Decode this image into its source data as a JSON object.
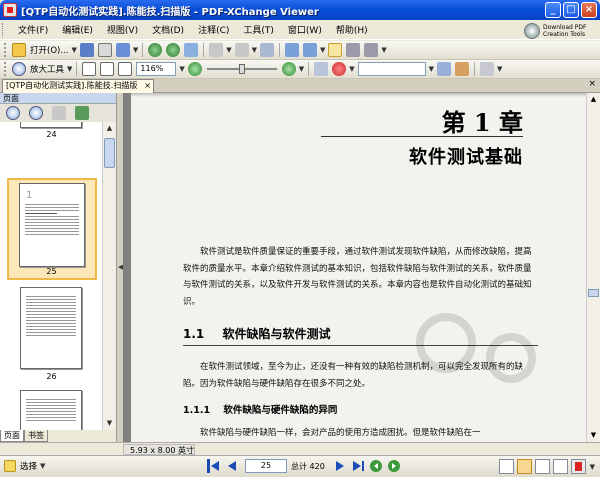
{
  "window": {
    "title": "[QTP自动化测试实践].陈能技.扫描版 - PDF-XChange Viewer"
  },
  "menu": {
    "items": [
      "文件(F)",
      "编辑(E)",
      "视图(V)",
      "文档(D)",
      "注释(C)",
      "工具(T)",
      "窗口(W)",
      "帮助(H)"
    ]
  },
  "download": {
    "line1": "Download PDF",
    "line2": "Creation Tools"
  },
  "toolbar1": {
    "open_label": "打开(O)..."
  },
  "toolbar2": {
    "zoom_tool_label": "放大工具",
    "zoom_value": "116%"
  },
  "doc_tab": {
    "label": "[QTP自动化测试实践].陈能技.扫描版"
  },
  "left_pane": {
    "title": "页面",
    "thumbnails": [
      {
        "label": "24"
      },
      {
        "label": "25"
      },
      {
        "label": "26"
      }
    ],
    "tabs": [
      "页面",
      "书签"
    ]
  },
  "page": {
    "chapter_number": "第 1 章",
    "chapter_title": "软件测试基础",
    "intro_paragraph": "软件测试是软件质量保证的重要手段，通过软件测试发现软件缺陷，从而修改缺陷，提高软件的质量水平。本章介绍软件测试的基本知识，包括软件缺陷与软件测试的关系，软件质量与软件测试的关系，以及软件开发与软件测试的关系。本章内容也是软件自动化测试的基础知识。",
    "section_number": "1.1",
    "section_title": "软件缺陷与软件测试",
    "section_paragraph": "在软件测试领域，至今为止，还没有一种有效的缺陷检测机制，可以完全发现所有的缺陷。因为软件缺陷与硬件缺陷存在很多不同之处。",
    "subsection_number": "1.1.1",
    "subsection_title": "软件缺陷与硬件缺陷的异同",
    "subsection_paragraph": "软件缺陷与硬件缺陷一样，会对产品的使用方造成困扰。但是软件缺陷在一"
  },
  "status": {
    "page_size": "5.93 x 8.00 英寸",
    "select_label": "选择",
    "current_page": "25",
    "total_pages": "总计 420"
  },
  "colors": {
    "titlebar": "#0a4fd8",
    "selection": "#f0b848",
    "page_background": "#f4f2ee",
    "workspace": "#808080"
  }
}
